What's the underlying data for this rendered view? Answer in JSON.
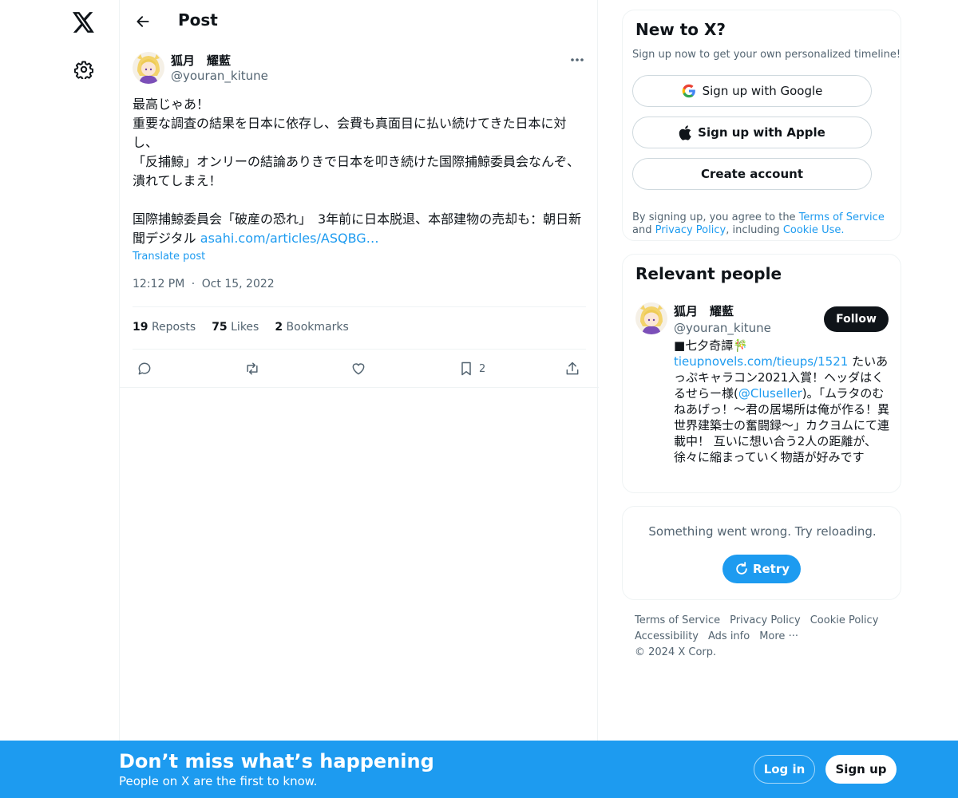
{
  "colors": {
    "accent": "#1d9bf0",
    "text": "#0f1419",
    "secondary": "#536471",
    "border": "#eff3f4",
    "bottom_bar": "#1d9bf0"
  },
  "nav": {
    "logo_icon": "x-logo-icon",
    "settings_icon": "gear-icon"
  },
  "header": {
    "title": "Post",
    "back_icon": "arrow-left-icon"
  },
  "post": {
    "author_name": "狐月　耀藍",
    "author_handle": "@youran_kitune",
    "text": "最高じゃあ！\n重要な調査の結果を日本に依存し、会費も真面目に払い続けてきた日本に対し、\n「反捕鯨」オンリーの結論ありきで日本を叩き続けた国際捕鯨委員会なんぞ、潰れてしまえ！\n\n国際捕鯨委員会「破産の恐れ」　3年前に日本脱退、本部建物の売却も：朝日新聞デジタル ",
    "link_text": "asahi.com/articles/ASQBG…",
    "translate": "Translate post",
    "time": "12:12 PM",
    "separator": "·",
    "date": "Oct 15, 2022",
    "stats": {
      "reposts_count": "19",
      "reposts_label": "Reposts",
      "likes_count": "75",
      "likes_label": "Likes",
      "bookmarks_count": "2",
      "bookmarks_label": "Bookmarks"
    },
    "actions": {
      "bookmark_count": "2"
    }
  },
  "signup_card": {
    "title": "New to X?",
    "subtitle": "Sign up now to get your own personalized timeline!",
    "google_label": "Sign up with Google",
    "apple_label": "Sign up with Apple",
    "create_label": "Create account",
    "legal_prefix": "By signing up, you agree to the ",
    "terms_link": "Terms of Service",
    "legal_and": " and ",
    "privacy_link": "Privacy Policy",
    "legal_including": ", including ",
    "cookie_link": "Cookie Use."
  },
  "relevant_people": {
    "title": "Relevant people",
    "name": "狐月　耀藍",
    "handle": "@youran_kitune",
    "follow_label": "Follow",
    "bio_1": "■七夕奇譚🎋",
    "bio_link": "tieupnovels.com/tieups/1521",
    "bio_2": " たいあっぷキャラコン2021入賞！ヘッダはくるせらー様(",
    "bio_mention": "@Cluseller",
    "bio_3": ")。「ムラタのむねあげっ！～君の居場所は俺が作る！異世界建築士の奮闘録～」カクヨムにて連載中！ 互いに想い合う2人の距離が、徐々に縮まっていく物語が好みです"
  },
  "error_card": {
    "message": "Something went wrong. Try reloading.",
    "retry_label": "Retry"
  },
  "footer": {
    "terms": "Terms of Service",
    "privacy": "Privacy Policy",
    "cookie": "Cookie Policy",
    "accessibility": "Accessibility",
    "ads": "Ads info",
    "more": "More ···",
    "copyright": "© 2024 X Corp."
  },
  "bottom_bar": {
    "title": "Don’t miss what’s happening",
    "subtitle": "People on X are the first to know.",
    "login_label": "Log in",
    "signup_label": "Sign up"
  }
}
